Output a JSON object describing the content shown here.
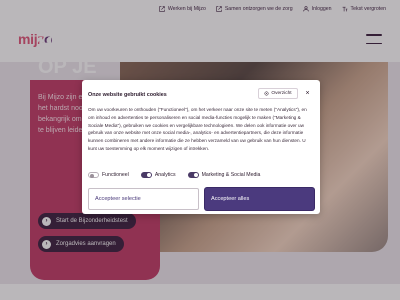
{
  "topbar": {
    "links": [
      {
        "label": "Werken bij Mijzo",
        "icon": "external-link-icon"
      },
      {
        "label": "Samen ontzorgen we de zorg",
        "icon": "link-icon"
      },
      {
        "label": "Inloggen",
        "icon": "user-icon"
      },
      {
        "label": "Tekst vergroten",
        "icon": "text-size-icon"
      }
    ]
  },
  "header": {
    "logo_text": "mijz",
    "logo_mark": "o",
    "menu_icon": "hamburger-icon"
  },
  "hero": {
    "title": "HOE H\nOP JE",
    "text": "Bij Mijzo zijn e\nhet hardst noo\nbekangrijk om\nte blijven leide",
    "primary_button": "Start de Bijzonderheidstest",
    "secondary_button": "Zorgadvies aanvragen"
  },
  "cookie_modal": {
    "title": "Onze website gebruikt cookies",
    "overview_label": "Overzicht",
    "close_label": "×",
    "body": "Om uw voorkeuren te onthouden (\"Functioneel\"), om het verkeer naar onze site te meten (\"Analytics\"), en om inhoud en advertenties te personaliseren en social media-functies mogelijk te maken (\"Marketing & Sociale Media\"), gebruiken we cookies en vergelijkbare technologieën. We delen ook informatie over uw gebruik van onze website met onze social media-, analytics- en advertentiepartners, die deze informatie kunnen combineren met andere informatie die ze hebben verzameld van uw gebruik van hun diensten. U kunt uw toestemming op elk moment wijzigen of intrekken.",
    "toggles": [
      {
        "label": "Functioneel",
        "on": false
      },
      {
        "label": "Analytics",
        "on": true
      },
      {
        "label": "Marketing & Social Media",
        "on": true
      }
    ],
    "select_button": "Accepteer selectie",
    "accept_all_button": "Accepteer alles"
  },
  "colors": {
    "brand_pink": "#c23b66",
    "brand_purple": "#4b3a7e",
    "text_dark": "#3c1f3e"
  }
}
